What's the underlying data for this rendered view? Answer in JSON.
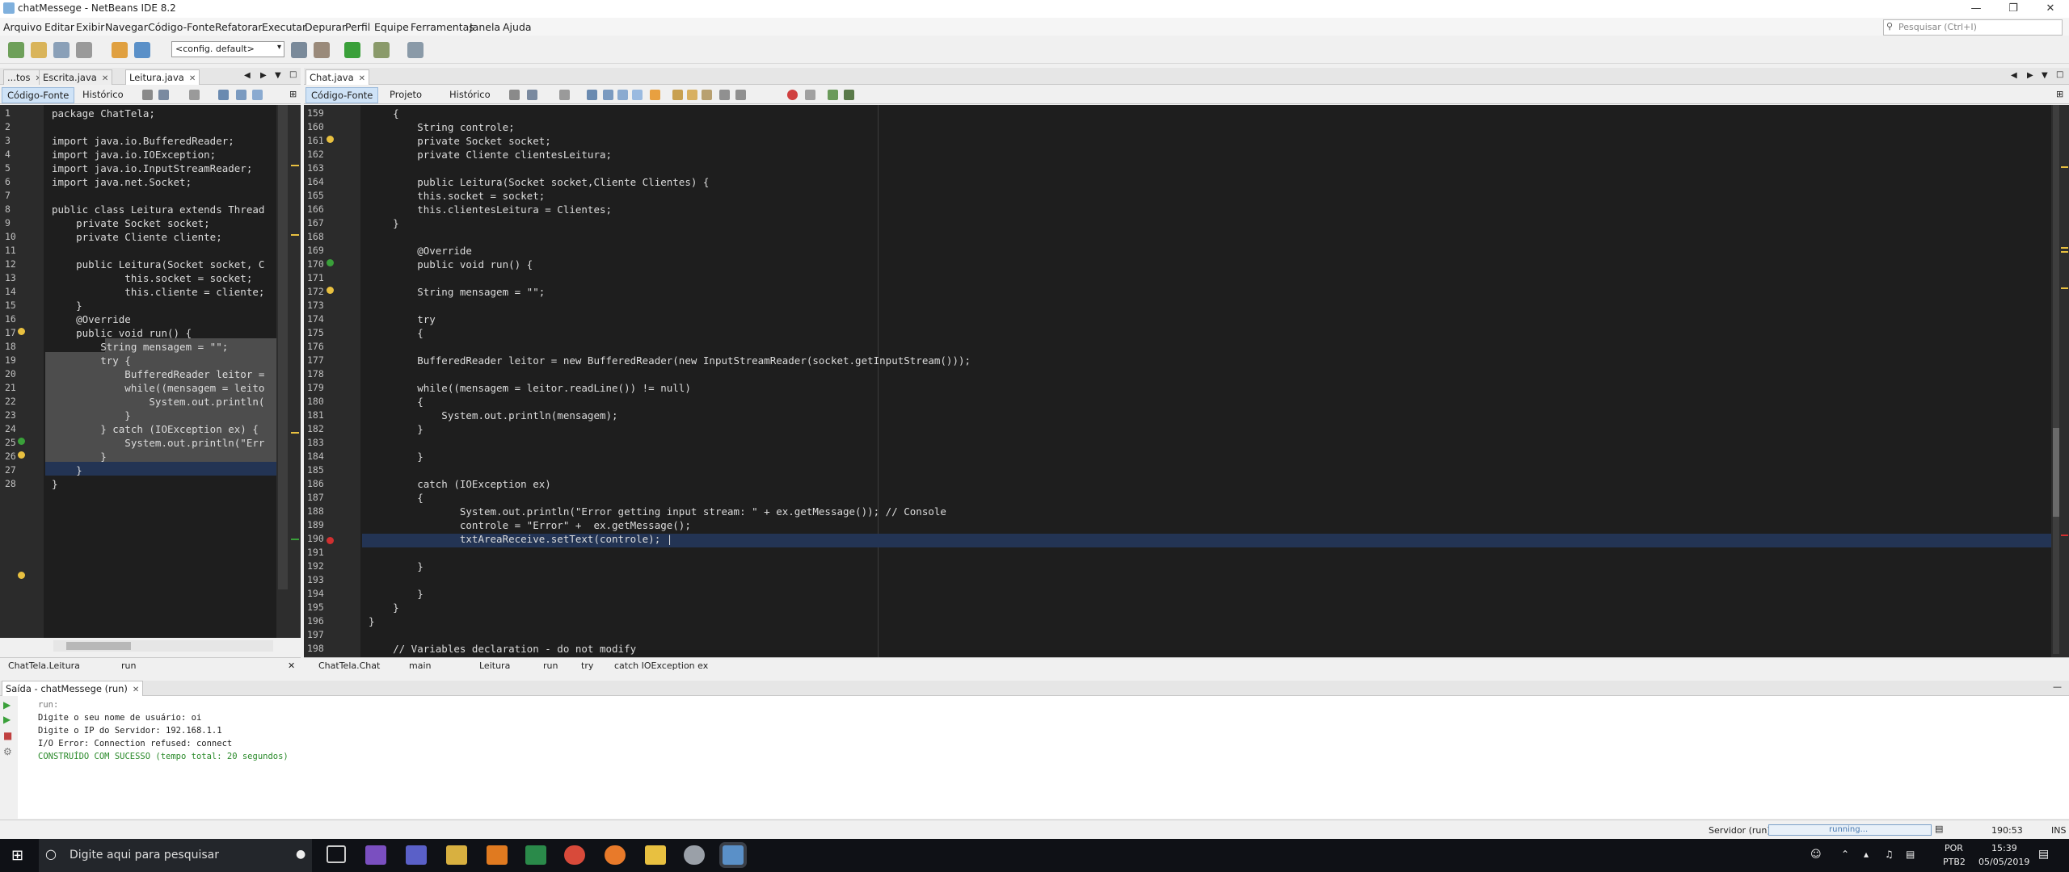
{
  "window": {
    "title": "chatMessege - NetBeans IDE 8.2"
  },
  "menu": [
    "Arquivo",
    "Editar",
    "Exibir",
    "Navegar",
    "Código-Fonte",
    "Refatorar",
    "Executar",
    "Depurar",
    "Perfil",
    "Equipe",
    "Ferramentas",
    "Janela",
    "Ajuda"
  ],
  "search": {
    "placeholder": "Pesquisar (Ctrl+I)"
  },
  "toolbar": {
    "config_value": "<config. default>"
  },
  "left_editor": {
    "tabs": [
      "...tos",
      "Escrita.java",
      "Leitura.java"
    ],
    "subtabs": [
      "Código-Fonte",
      "Histórico"
    ],
    "lines": [
      {
        "n": "1",
        "t": "package ChatTela;"
      },
      {
        "n": "2",
        "t": ""
      },
      {
        "n": "3",
        "t": "import java.io.BufferedReader;"
      },
      {
        "n": "4",
        "t": "import java.io.IOException;"
      },
      {
        "n": "5",
        "t": "import java.io.InputStreamReader;"
      },
      {
        "n": "6",
        "t": "import java.net.Socket;"
      },
      {
        "n": "7",
        "t": ""
      },
      {
        "n": "8",
        "t": "public class Leitura extends Thread"
      },
      {
        "n": "9",
        "t": "    private Socket socket;"
      },
      {
        "n": "10",
        "t": "    private Cliente cliente;"
      },
      {
        "n": "11",
        "t": ""
      },
      {
        "n": "12",
        "t": "    public Leitura(Socket socket, C"
      },
      {
        "n": "13",
        "t": "            this.socket = socket;"
      },
      {
        "n": "14",
        "t": "            this.cliente = cliente;"
      },
      {
        "n": "15",
        "t": "    }"
      },
      {
        "n": "16",
        "t": "    @Override"
      },
      {
        "n": "17",
        "t": "    public void run() {"
      },
      {
        "n": "18",
        "t": "        String mensagem = \"\";"
      },
      {
        "n": "19",
        "t": "        try {"
      },
      {
        "n": "20",
        "t": "            BufferedReader leitor ="
      },
      {
        "n": "21",
        "t": "            while((mensagem = leito"
      },
      {
        "n": "22",
        "t": "                System.out.println("
      },
      {
        "n": "23",
        "t": "            }"
      },
      {
        "n": "24",
        "t": "        } catch (IOException ex) {"
      },
      {
        "n": "25",
        "t": "            System.out.println(\"Err"
      },
      {
        "n": "26",
        "t": "        }"
      },
      {
        "n": "27",
        "t": "    }"
      },
      {
        "n": "28",
        "t": "}"
      }
    ],
    "breadcrumb": [
      "ChatTela.Leitura",
      "run"
    ]
  },
  "right_editor": {
    "tabs": [
      "Chat.java"
    ],
    "subtabs": [
      "Código-Fonte",
      "Projeto",
      "Histórico"
    ],
    "lines": [
      {
        "n": "159",
        "t": "    {"
      },
      {
        "n": "160",
        "t": "        String controle;"
      },
      {
        "n": "161",
        "t": "        private Socket socket;"
      },
      {
        "n": "162",
        "t": "        private Cliente clientesLeitura;"
      },
      {
        "n": "163",
        "t": ""
      },
      {
        "n": "164",
        "t": "        public Leitura(Socket socket,Cliente Clientes) {"
      },
      {
        "n": "165",
        "t": "        this.socket = socket;"
      },
      {
        "n": "166",
        "t": "        this.clientesLeitura = Clientes;"
      },
      {
        "n": "167",
        "t": "    }"
      },
      {
        "n": "168",
        "t": ""
      },
      {
        "n": "169",
        "t": "        @Override"
      },
      {
        "n": "170",
        "t": "        public void run() {"
      },
      {
        "n": "171",
        "t": ""
      },
      {
        "n": "172",
        "t": "        String mensagem = \"\";"
      },
      {
        "n": "173",
        "t": ""
      },
      {
        "n": "174",
        "t": "        try"
      },
      {
        "n": "175",
        "t": "        {"
      },
      {
        "n": "176",
        "t": ""
      },
      {
        "n": "177",
        "t": "        BufferedReader leitor = new BufferedReader(new InputStreamReader(socket.getInputStream()));"
      },
      {
        "n": "178",
        "t": ""
      },
      {
        "n": "179",
        "t": "        while((mensagem = leitor.readLine()) != null)"
      },
      {
        "n": "180",
        "t": "        {"
      },
      {
        "n": "181",
        "t": "            System.out.println(mensagem);"
      },
      {
        "n": "182",
        "t": "        }"
      },
      {
        "n": "183",
        "t": ""
      },
      {
        "n": "184",
        "t": "        }"
      },
      {
        "n": "185",
        "t": ""
      },
      {
        "n": "186",
        "t": "        catch (IOException ex)"
      },
      {
        "n": "187",
        "t": "        {"
      },
      {
        "n": "188",
        "t": "               System.out.println(\"Error getting input stream: \" + ex.getMessage()); // Console"
      },
      {
        "n": "189",
        "t": "               controle = \"Error\" +  ex.getMessage();"
      },
      {
        "n": "190",
        "t": "               txtAreaReceive.setText(controle); |"
      },
      {
        "n": "191",
        "t": ""
      },
      {
        "n": "192",
        "t": "        }"
      },
      {
        "n": "193",
        "t": ""
      },
      {
        "n": "194",
        "t": "        }"
      },
      {
        "n": "195",
        "t": "    }"
      },
      {
        "n": "196",
        "t": "}"
      },
      {
        "n": "197",
        "t": ""
      },
      {
        "n": "198",
        "t": "    // Variables declaration - do not modify"
      }
    ],
    "breadcrumb": [
      "ChatTela.Chat",
      "main",
      "Leitura",
      "run",
      "try",
      "catch IOException ex"
    ]
  },
  "output": {
    "title": "Saída - chatMessege (run)",
    "lines": [
      "run:",
      "Digite o seu nome de usuário: oi",
      "Digite o IP do Servidor: 192.168.1.1",
      "I/O Error: Connection refused: connect",
      "CONSTRUÍDO COM SUCESSO (tempo total: 20 segundos)"
    ]
  },
  "status": {
    "process": "Servidor (run)",
    "progress_text": "running...",
    "position": "190:53",
    "mode": "INS"
  },
  "taskbar": {
    "search_placeholder": "Digite aqui para pesquisar",
    "lang": "POR",
    "layout": "PTB2",
    "time": "15:39",
    "date": "05/05/2019"
  }
}
